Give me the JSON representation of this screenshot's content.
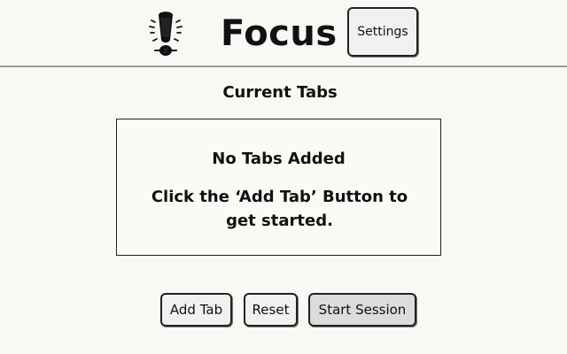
{
  "header": {
    "logo_icon": "exclamation-icon",
    "title": "Focus",
    "settings_label": "Settings"
  },
  "main": {
    "section_title": "Current Tabs",
    "empty_state": {
      "title": "No Tabs Added",
      "hint": "Click the ‘Add Tab’ Button to get started."
    }
  },
  "actions": {
    "add_tab_label": "Add Tab",
    "reset_label": "Reset",
    "start_session_label": "Start Session"
  },
  "colors": {
    "background": "#f8f8f4",
    "button_background": "#f1f1f1",
    "start_button_background": "#dcdcdc",
    "text": "#111111"
  }
}
